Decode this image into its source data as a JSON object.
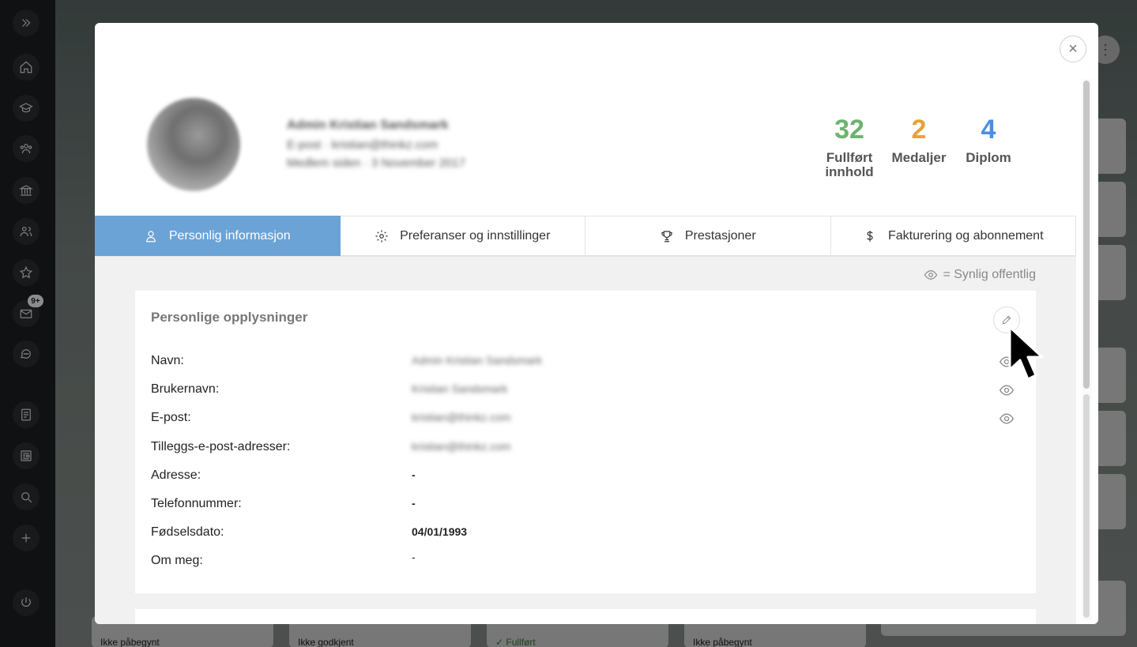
{
  "sidebar": {
    "items": [
      {
        "name": "expand-icon"
      },
      {
        "name": "home-icon"
      },
      {
        "name": "graduation-cap-icon"
      },
      {
        "name": "users-group-icon"
      },
      {
        "name": "institution-icon"
      },
      {
        "name": "users-icon"
      },
      {
        "name": "star-icon"
      },
      {
        "name": "mail-icon",
        "badge": "9+"
      },
      {
        "name": "chat-icon"
      },
      {
        "name": "document-icon"
      },
      {
        "name": "newspaper-icon"
      },
      {
        "name": "search-icon"
      },
      {
        "name": "plus-icon"
      },
      {
        "name": "power-icon"
      }
    ]
  },
  "background": {
    "statuses": [
      "Ikke påbegynt",
      "Ikke godkjent",
      "✓ Fullført",
      "Ikke påbegynt"
    ]
  },
  "profile": {
    "name": "Admin Kristian Sandsmark",
    "email_line": "E-post · kristian@thinkz.com",
    "member_line": "Medlem siden · 3 November 2017"
  },
  "stats": [
    {
      "value": "32",
      "label_line1": "Fullført",
      "label_line2": "innhold",
      "color": "#6db36f"
    },
    {
      "value": "2",
      "label_line1": "Medaljer",
      "label_line2": "",
      "color": "#e8a13a"
    },
    {
      "value": "4",
      "label_line1": "Diplom",
      "label_line2": "",
      "color": "#4a8fe0"
    }
  ],
  "tabs": [
    {
      "label": "Personlig informasjon",
      "icon": "user-icon",
      "active": true
    },
    {
      "label": "Preferanser og innstillinger",
      "icon": "gear-icon",
      "active": false
    },
    {
      "label": "Prestasjoner",
      "icon": "trophy-icon",
      "active": false
    },
    {
      "label": "Fakturering og abonnement",
      "icon": "dollar-icon",
      "active": false
    }
  ],
  "visibility_note": "= Synlig offentlig",
  "card": {
    "title": "Personlige opplysninger",
    "rows": [
      {
        "label": "Navn:",
        "value": "Admin Kristian Sandsmark",
        "blurred": true,
        "public": true
      },
      {
        "label": "Brukernavn:",
        "value": "Kristian Sandsmark",
        "blurred": true,
        "public": true
      },
      {
        "label": "E-post:",
        "value": "kristian@thinkz.com",
        "blurred": true,
        "public": true
      },
      {
        "label": "Tilleggs-e-post-adresser:",
        "value": "kristian@thinkz.com",
        "blurred": true,
        "public": false
      },
      {
        "label": "Adresse:",
        "value": "-",
        "blurred": false,
        "public": false
      },
      {
        "label": "Telefonnummer:",
        "value": "-",
        "blurred": false,
        "public": false
      },
      {
        "label": "Fødselsdato:",
        "value": "04/01/1993",
        "blurred": false,
        "public": false
      },
      {
        "label": "Om meg:",
        "value": "-",
        "blurred": false,
        "public": false
      }
    ]
  }
}
